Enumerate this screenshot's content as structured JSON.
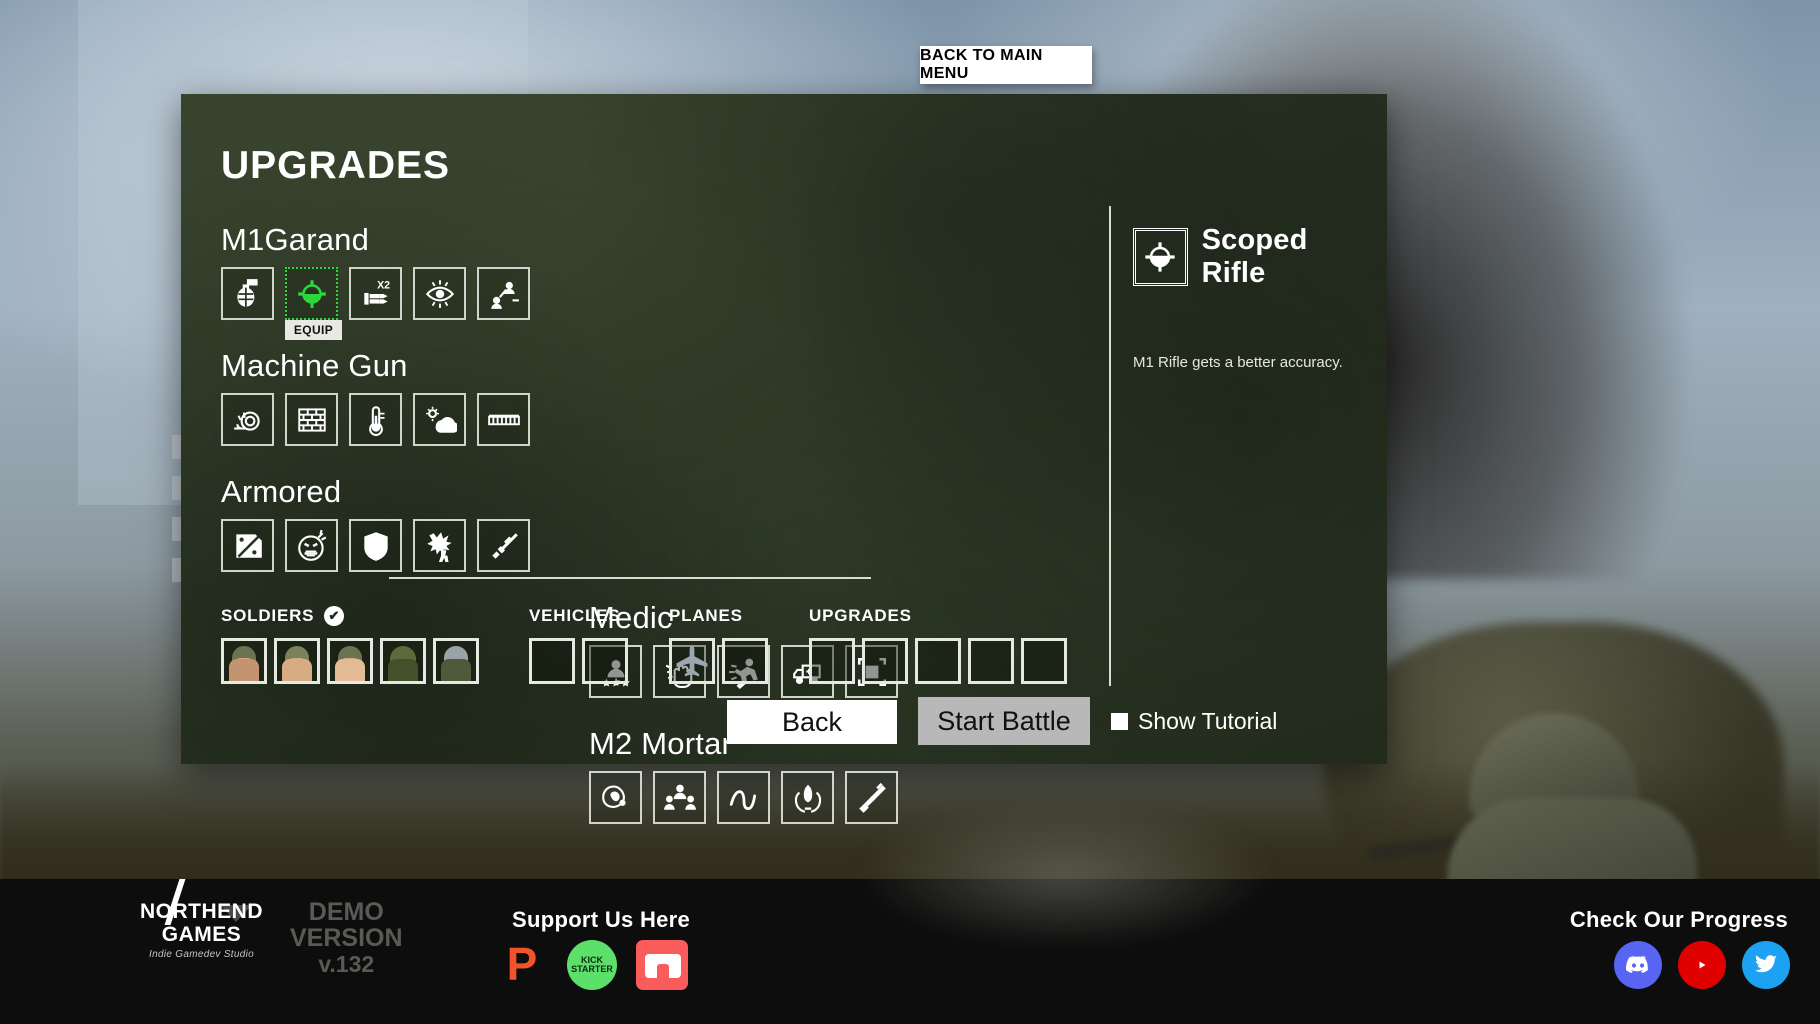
{
  "window": {
    "back_to_main_menu": "BACK TO MAIN MENU"
  },
  "panel": {
    "title": "UPGRADES"
  },
  "categories": [
    {
      "id": "m1garand",
      "name": "M1Garand",
      "slots": [
        {
          "icon": "grenade-icon",
          "selected": false,
          "label": ""
        },
        {
          "icon": "scope-crosshair-icon",
          "selected": true,
          "label": "EQUIP"
        },
        {
          "icon": "double-ammo-icon",
          "selected": false,
          "label": ""
        },
        {
          "icon": "eye-vision-icon",
          "selected": false,
          "label": ""
        },
        {
          "icon": "squad-link-icon",
          "selected": false,
          "label": ""
        }
      ]
    },
    {
      "id": "medic",
      "name": "Medic",
      "slots": [
        {
          "icon": "person-stars-icon",
          "selected": false,
          "label": ""
        },
        {
          "icon": "healing-hand-icon",
          "selected": false,
          "label": ""
        },
        {
          "icon": "running-person-icon",
          "selected": false,
          "label": ""
        },
        {
          "icon": "medic-truck-icon",
          "selected": false,
          "label": ""
        },
        {
          "icon": "deploy-zone-icon",
          "selected": false,
          "label": ""
        }
      ]
    },
    {
      "id": "machinegun",
      "name": "Machine Gun",
      "slots": [
        {
          "icon": "snail-slow-icon",
          "selected": false,
          "label": ""
        },
        {
          "icon": "brick-wall-icon",
          "selected": false,
          "label": ""
        },
        {
          "icon": "thermometer-icon",
          "selected": false,
          "label": ""
        },
        {
          "icon": "cloud-weather-icon",
          "selected": false,
          "label": ""
        },
        {
          "icon": "ammo-belt-icon",
          "selected": false,
          "label": ""
        }
      ]
    },
    {
      "id": "m2mortar",
      "name": "M2 Mortar",
      "slots": [
        {
          "icon": "blast-zone-icon",
          "selected": false,
          "label": ""
        },
        {
          "icon": "crew-group-icon",
          "selected": false,
          "label": ""
        },
        {
          "icon": "trajectory-icon",
          "selected": false,
          "label": ""
        },
        {
          "icon": "shell-hands-icon",
          "selected": false,
          "label": ""
        },
        {
          "icon": "rifle-icon",
          "selected": false,
          "label": ""
        }
      ]
    },
    {
      "id": "armored",
      "name": "Armored",
      "slots": [
        {
          "icon": "armor-plate-icon",
          "selected": false,
          "label": ""
        },
        {
          "icon": "angry-bomb-icon",
          "selected": false,
          "label": ""
        },
        {
          "icon": "shield-icon",
          "selected": false,
          "label": ""
        },
        {
          "icon": "soldier-hit-icon",
          "selected": false,
          "label": ""
        },
        {
          "icon": "smg-gun-icon",
          "selected": false,
          "label": ""
        }
      ]
    }
  ],
  "info": {
    "icon": "scope-crosshair-icon",
    "title": "Scoped Rifle",
    "description": "M1 Rifle gets a better accuracy."
  },
  "loadout": [
    {
      "label": "SOLDIERS",
      "checked": true,
      "check_glyph": "✔",
      "slots": [
        {
          "kind": "soldier",
          "variant": "s1",
          "filled": true
        },
        {
          "kind": "soldier",
          "variant": "s2",
          "filled": true
        },
        {
          "kind": "soldier",
          "variant": "s3",
          "filled": true
        },
        {
          "kind": "soldier",
          "variant": "s4",
          "filled": true
        },
        {
          "kind": "soldier",
          "variant": "s5",
          "filled": true
        }
      ]
    },
    {
      "label": "VEHICLES",
      "checked": false,
      "check_glyph": "",
      "slots": [
        {
          "kind": "empty",
          "variant": "",
          "filled": false
        },
        {
          "kind": "empty",
          "variant": "",
          "filled": false
        }
      ]
    },
    {
      "label": "PLANES",
      "checked": false,
      "check_glyph": "",
      "slots": [
        {
          "kind": "plane",
          "variant": "",
          "filled": true
        },
        {
          "kind": "empty",
          "variant": "",
          "filled": false
        }
      ]
    },
    {
      "label": "UPGRADES",
      "checked": false,
      "check_glyph": "",
      "slots": [
        {
          "kind": "empty",
          "variant": "",
          "filled": false
        },
        {
          "kind": "empty",
          "variant": "",
          "filled": false
        },
        {
          "kind": "empty",
          "variant": "",
          "filled": false
        },
        {
          "kind": "empty",
          "variant": "",
          "filled": false
        },
        {
          "kind": "empty",
          "variant": "",
          "filled": false
        }
      ]
    }
  ],
  "footer": {
    "back": "Back",
    "start_battle": "Start Battle",
    "show_tutorial": "Show Tutorial"
  },
  "branding": {
    "studio_line1": "NORTHEND",
    "studio_line2": "GAMES",
    "studio_tagline": "Indie Gamedev Studio",
    "demo_line1": "DEMO",
    "demo_line2": "VERSION",
    "demo_version": "v.132",
    "support_label": "Support Us Here",
    "progress_label": "Check Our Progress",
    "kick_line1": "KICK",
    "kick_line2": "STARTER",
    "patreon_glyph": "P"
  },
  "colors": {
    "accent_green": "#2bd93c",
    "panel_dark": "#283322",
    "white": "#ffffff"
  }
}
